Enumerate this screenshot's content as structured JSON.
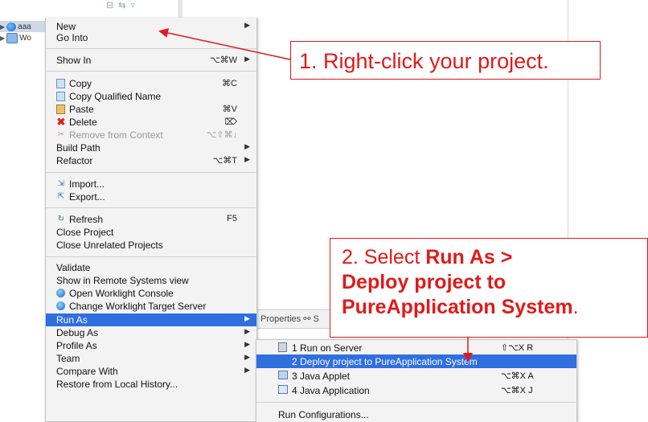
{
  "tree": {
    "project_label": "aaa",
    "workspace_label": "Wo"
  },
  "menu": {
    "new": "New",
    "go_into": "Go Into",
    "show_in": "Show In",
    "show_in_sc": "⌥⌘W",
    "copy": "Copy",
    "copy_sc": "⌘C",
    "copy_qualified": "Copy Qualified Name",
    "paste": "Paste",
    "paste_sc": "⌘V",
    "delete": "Delete",
    "delete_sc": "⌦",
    "remove_context": "Remove from Context",
    "remove_context_sc": "⌥⇧⌘↓",
    "build_path": "Build Path",
    "refactor": "Refactor",
    "refactor_sc": "⌥⌘T",
    "import": "Import...",
    "export": "Export...",
    "refresh": "Refresh",
    "refresh_sc": "F5",
    "close_project": "Close Project",
    "close_unrelated": "Close Unrelated Projects",
    "validate": "Validate",
    "show_remote": "Show in Remote Systems view",
    "open_worklight": "Open Worklight Console",
    "change_worklight": "Change Worklight Target Server",
    "run_as": "Run As",
    "debug_as": "Debug As",
    "profile_as": "Profile As",
    "team": "Team",
    "compare_with": "Compare With",
    "restore_history": "Restore from Local History..."
  },
  "submenu": {
    "run_on_server": "1 Run on Server",
    "run_on_server_sc": "⇧⌥X R",
    "deploy": "2 Deploy project to PureApplication System",
    "java_applet": "3 Java Applet",
    "java_applet_sc": "⌥⌘X A",
    "java_app": "4 Java Application",
    "java_app_sc": "⌥⌘X J",
    "run_configs": "Run Configurations..."
  },
  "views_bar": {
    "text": "Properties  ⚯ S"
  },
  "callouts": {
    "step1": "1. Right-click your project.",
    "step2_prefix": "2. Select ",
    "step2_bold1": "Run As >",
    "step2_bold2": "Deploy project to",
    "step2_bold3": "PureApplication System",
    "step2_suffix": "."
  },
  "colors": {
    "accent": "#2f6fe0",
    "callout": "#e01a1a"
  }
}
